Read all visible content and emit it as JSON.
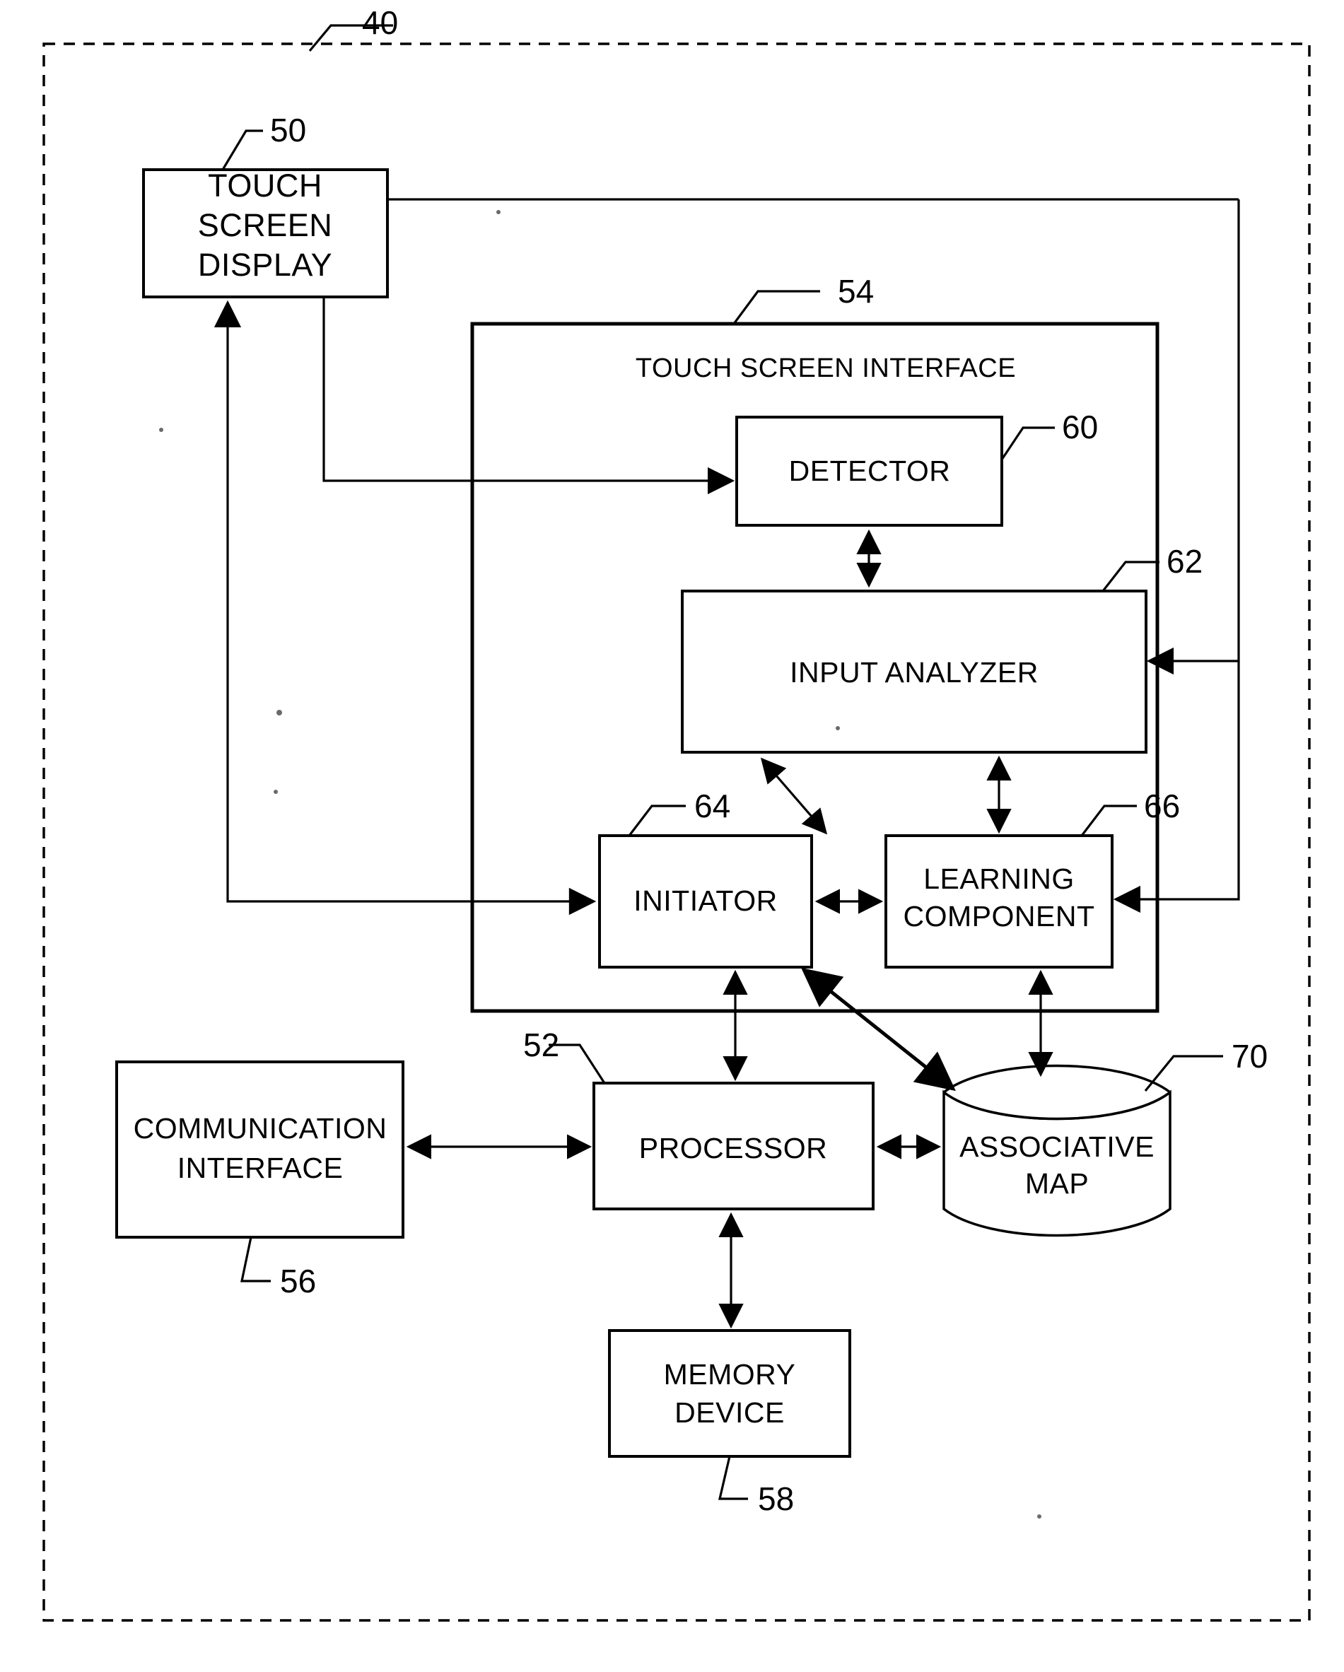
{
  "figure": {
    "system_reference": "40",
    "blocks": [
      {
        "id": "touch_screen_display",
        "label_lines": [
          "TOUCH",
          "SCREEN",
          "DISPLAY"
        ],
        "reference": "50"
      },
      {
        "id": "touch_screen_interface",
        "label_lines": [
          "TOUCH SCREEN INTERFACE"
        ],
        "reference": "54"
      },
      {
        "id": "detector",
        "label_lines": [
          "DETECTOR"
        ],
        "reference": "60"
      },
      {
        "id": "input_analyzer",
        "label_lines": [
          "INPUT ANALYZER"
        ],
        "reference": "62"
      },
      {
        "id": "initiator",
        "label_lines": [
          "INITIATOR"
        ],
        "reference": "64"
      },
      {
        "id": "learning_component",
        "label_lines": [
          "LEARNING",
          "COMPONENT"
        ],
        "reference": "66"
      },
      {
        "id": "processor",
        "label_lines": [
          "PROCESSOR"
        ],
        "reference": "52"
      },
      {
        "id": "communication_interface",
        "label_lines": [
          "COMMUNICATION",
          "INTERFACE"
        ],
        "reference": "56"
      },
      {
        "id": "memory_device",
        "label_lines": [
          "MEMORY",
          "DEVICE"
        ],
        "reference": "58"
      },
      {
        "id": "associative_map",
        "label_lines": [
          "ASSOCIATIVE",
          "MAP"
        ],
        "reference": "70"
      }
    ],
    "text": {
      "touch_screen_display_line1": "TOUCH",
      "touch_screen_display_line2": "SCREEN",
      "touch_screen_display_line3": "DISPLAY",
      "touch_screen_interface_title": "TOUCH SCREEN INTERFACE",
      "detector": "DETECTOR",
      "input_analyzer": "INPUT ANALYZER",
      "initiator": "INITIATOR",
      "learning_component_line1": "LEARNING",
      "learning_component_line2": "COMPONENT",
      "processor": "PROCESSOR",
      "communication_interface_line1": "COMMUNICATION",
      "communication_interface_line2": "INTERFACE",
      "memory_device_line1": "MEMORY",
      "memory_device_line2": "DEVICE",
      "associative_map_line1": "ASSOCIATIVE",
      "associative_map_line2": "MAP"
    },
    "reference_numerals": {
      "system": "40",
      "touch_screen_display": "50",
      "processor": "52",
      "touch_screen_interface": "54",
      "communication_interface": "56",
      "memory_device": "58",
      "detector": "60",
      "input_analyzer": "62",
      "initiator": "64",
      "learning_component": "66",
      "associative_map": "70"
    },
    "colors": {
      "stroke": "#000000",
      "fill": "#ffffff",
      "background": "#ffffff"
    }
  }
}
